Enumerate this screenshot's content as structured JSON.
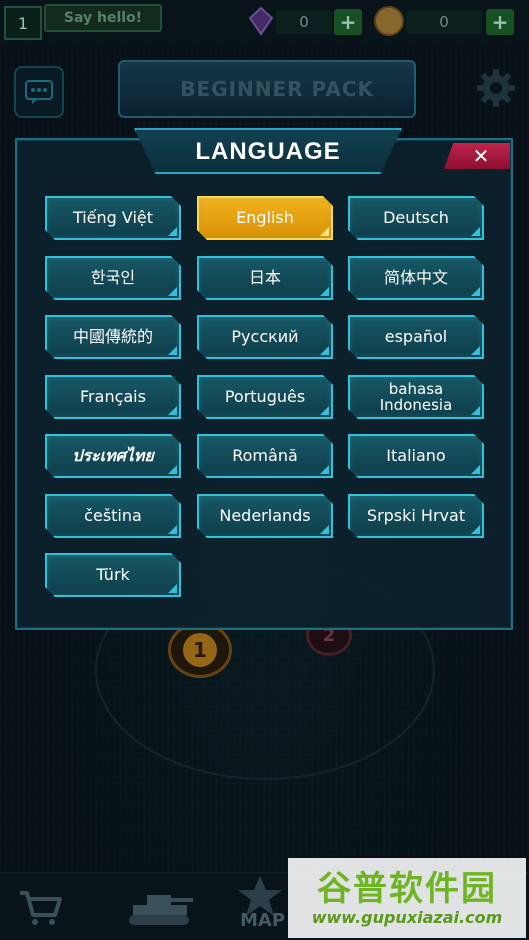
{
  "topbar": {
    "level": "1",
    "say_hello": "Say hello!",
    "gems": "0",
    "coins": "0",
    "plus": "+"
  },
  "banner": {
    "label": "BEGINNER PACK"
  },
  "map": {
    "node1": "1",
    "node2": "2",
    "label": "MAP"
  },
  "dialog": {
    "title": "LANGUAGE",
    "close": "✕",
    "languages": [
      "Tiếng Việt",
      "English",
      "Deutsch",
      "한국인",
      "日本",
      "简体中文",
      "中國傳統的",
      "Русский",
      "español",
      "Français",
      "Português",
      "bahasa Indonesia",
      "ประเทศไทย",
      "Română",
      "Italiano",
      "čeština",
      "Nederlands",
      "Srpski Hrvat",
      "Türk"
    ],
    "selected": "English"
  },
  "watermark": {
    "title": "谷普软件园",
    "url": "www.gupuxiazai.com"
  },
  "colors": {
    "accent": "#35bfd8",
    "selected": "#f2b21c",
    "close": "#c0234b",
    "panel": "#0b212c"
  }
}
